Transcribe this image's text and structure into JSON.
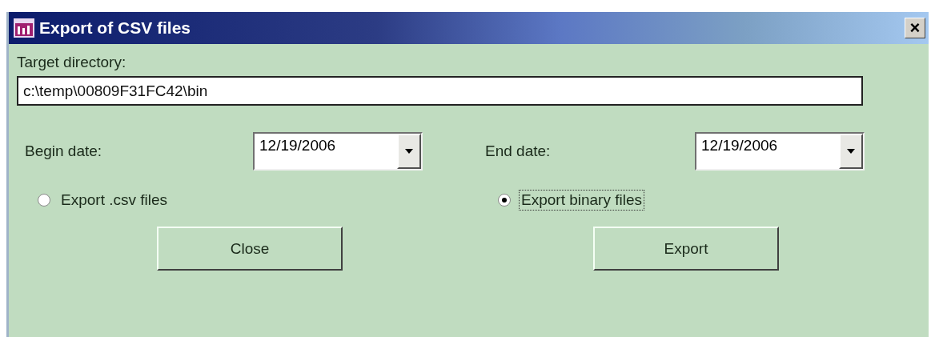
{
  "window": {
    "title": "Export of CSV files",
    "close": "×"
  },
  "target": {
    "label": "Target directory:",
    "value": "c:\\temp\\00809F31FC42\\bin"
  },
  "dates": [
    {
      "label": "Begin date:",
      "value": "12/19/2006"
    },
    {
      "label": "End date:",
      "value": "12/19/2006"
    }
  ],
  "options": [
    {
      "label": "Export .csv files",
      "selected": false,
      "focused": false
    },
    {
      "label": "Export binary files",
      "selected": true,
      "focused": true
    }
  ],
  "buttons": [
    "Close",
    "Export"
  ]
}
